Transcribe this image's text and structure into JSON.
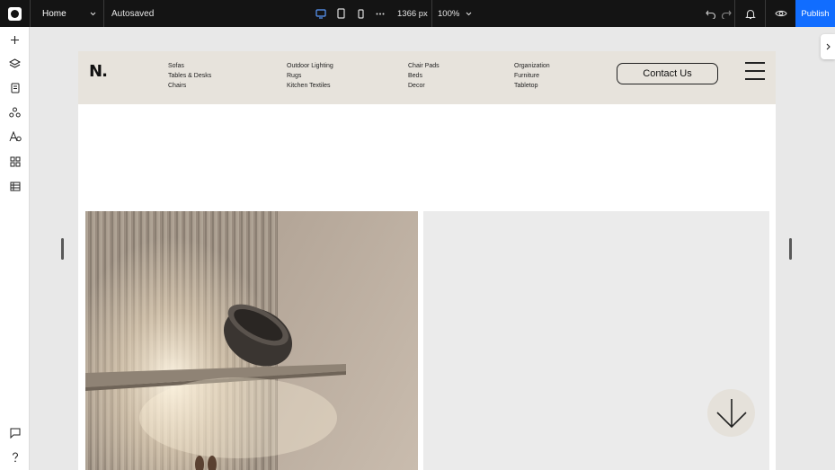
{
  "editor": {
    "page_selector": "Home",
    "save_status": "Autosaved",
    "canvas_width": "1366 px",
    "zoom": "100%",
    "publish_label": "Publish",
    "accent_color": "#116dff",
    "device_icons": [
      "desktop-icon",
      "tablet-icon",
      "mobile-icon"
    ],
    "left_rail_icons": [
      "add-icon",
      "layers-icon",
      "pages-icon",
      "apps-icon",
      "design-icon",
      "blocks-icon",
      "cms-table-icon",
      "chat-icon",
      "help-icon"
    ]
  },
  "site": {
    "brand": "N.",
    "nav_columns": [
      [
        "Sofas",
        "Tables & Desks",
        "Chairs"
      ],
      [
        "Outdoor Lighting",
        "Rugs",
        "Kitchen Textiles"
      ],
      [
        "Chair Pads",
        "Beds",
        "Decor"
      ],
      [
        "Organization",
        "Furniture",
        "Tabletop"
      ]
    ],
    "contact_label": "Contact Us",
    "header_color": "#e7e3dc"
  }
}
